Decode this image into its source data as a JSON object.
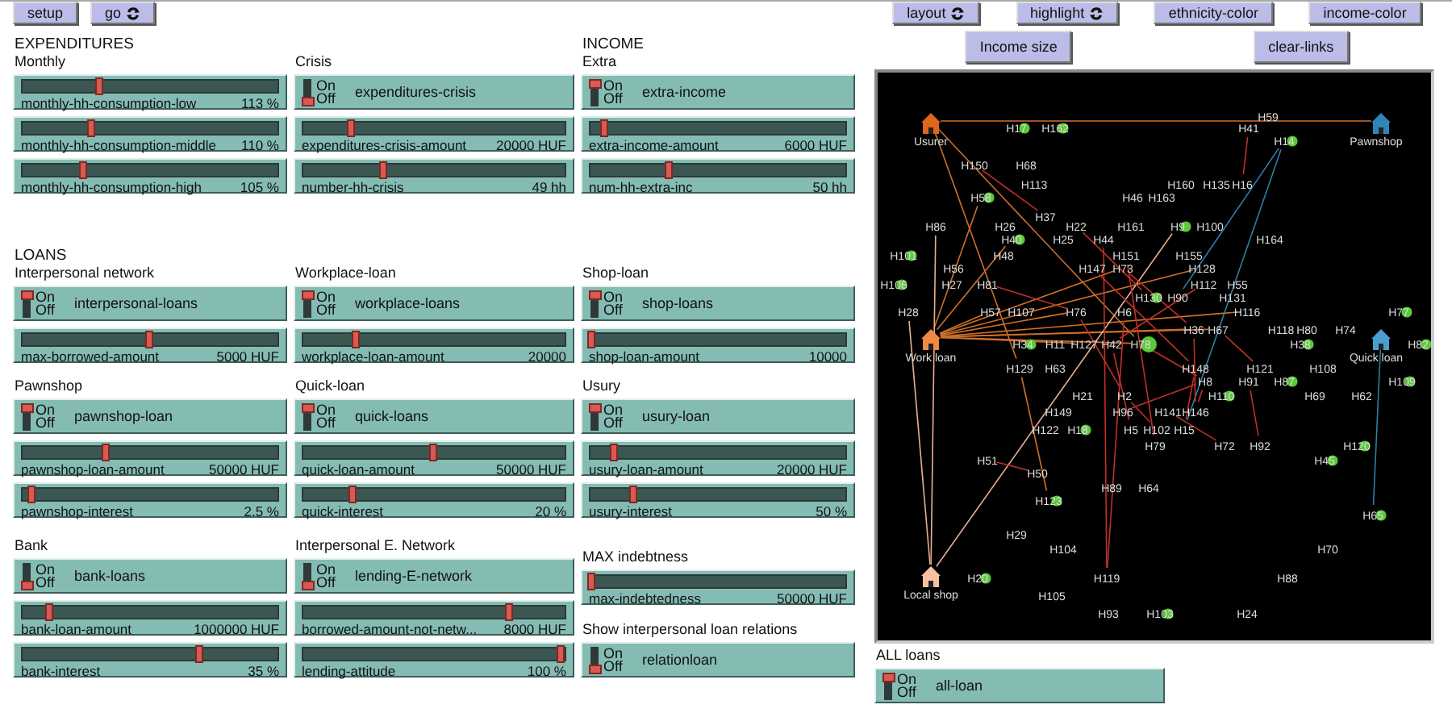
{
  "toolbar": [
    {
      "label": "setup",
      "forever": false
    },
    {
      "label": "go",
      "forever": true
    }
  ],
  "rows": [
    {
      "cells": [
        {
          "heading": "EXPENDITURES",
          "groups": [
            {
              "title": "Monthly",
              "widgets": [
                {
                  "kind": "slider",
                  "name": "monthly-hh-consumption-low",
                  "value": "113 %",
                  "level": 0.3
                },
                {
                  "kind": "slider",
                  "name": "monthly-hh-consumption-middle",
                  "value": "110 %",
                  "level": 0.27
                },
                {
                  "kind": "slider",
                  "name": "monthly-hh-consumption-high",
                  "value": "105 %",
                  "level": 0.24
                }
              ]
            }
          ]
        },
        {
          "groups": [
            {
              "title": "Crisis",
              "widgets": [
                {
                  "kind": "switch",
                  "name": "expenditures-crisis",
                  "on_label": "On",
                  "off_label": "Off",
                  "on": false
                },
                {
                  "kind": "slider",
                  "name": "expenditures-crisis-amount",
                  "value": "20000 HUF",
                  "level": 0.18
                },
                {
                  "kind": "slider",
                  "name": "number-hh-crisis",
                  "value": "49 hh",
                  "level": 0.31
                }
              ]
            }
          ]
        },
        {
          "heading": "INCOME",
          "groups": [
            {
              "title": "Extra",
              "widgets": [
                {
                  "kind": "switch",
                  "name": "extra-income",
                  "on_label": "On",
                  "off_label": "Off",
                  "on": true
                },
                {
                  "kind": "slider",
                  "name": "extra-income-amount",
                  "value": "6000 HUF",
                  "level": 0.05
                },
                {
                  "kind": "slider",
                  "name": "num-hh-extra-inc",
                  "value": "50 hh",
                  "level": 0.31
                }
              ]
            }
          ]
        }
      ]
    },
    {
      "cells": [
        {
          "heading": "LOANS",
          "groups": [
            {
              "title": "Interpersonal network",
              "widgets": [
                {
                  "kind": "switch",
                  "name": "interpersonal-loans",
                  "on_label": "On",
                  "off_label": "Off",
                  "on": true
                },
                {
                  "kind": "slider",
                  "name": "max-borrowed-amount",
                  "value": "5000 HUF",
                  "level": 0.5
                }
              ]
            }
          ]
        },
        {
          "groups": [
            {
              "title": "Workplace-loan",
              "widgets": [
                {
                  "kind": "switch",
                  "name": "workplace-loans",
                  "on_label": "On",
                  "off_label": "Off",
                  "on": true
                },
                {
                  "kind": "slider",
                  "name": "workplace-loan-amount",
                  "value": "20000",
                  "level": 0.2
                }
              ]
            }
          ]
        },
        {
          "groups": [
            {
              "title": "Shop-loan",
              "widgets": [
                {
                  "kind": "switch",
                  "name": "shop-loans",
                  "on_label": "On",
                  "off_label": "Off",
                  "on": true
                },
                {
                  "kind": "slider",
                  "name": "shop-loan-amount",
                  "value": "10000",
                  "level": 0
                }
              ]
            }
          ]
        }
      ]
    },
    {
      "cells": [
        {
          "groups": [
            {
              "title": "Pawnshop",
              "widgets": [
                {
                  "kind": "switch",
                  "name": "pawnshop-loan",
                  "on_label": "On",
                  "off_label": "Off",
                  "on": true
                },
                {
                  "kind": "slider",
                  "name": "pawnshop-loan-amount",
                  "value": "50000 HUF",
                  "level": 0.33
                },
                {
                  "kind": "slider",
                  "name": "pawnshop-interest",
                  "value": "2.5 %",
                  "level": 0.03
                }
              ]
            }
          ]
        },
        {
          "groups": [
            {
              "title": "Quick-loan",
              "widgets": [
                {
                  "kind": "switch",
                  "name": "quick-loans",
                  "on_label": "On",
                  "off_label": "Off",
                  "on": true
                },
                {
                  "kind": "slider",
                  "name": "quick-loan-amount",
                  "value": "50000 HUF",
                  "level": 0.5
                },
                {
                  "kind": "slider",
                  "name": "quick-interest",
                  "value": "20 %",
                  "level": 0.19
                }
              ]
            }
          ]
        },
        {
          "groups": [
            {
              "title": "Usury",
              "widgets": [
                {
                  "kind": "switch",
                  "name": "usury-loan",
                  "on_label": "On",
                  "off_label": "Off",
                  "on": true
                },
                {
                  "kind": "slider",
                  "name": "usury-loan-amount",
                  "value": "20000 HUF",
                  "level": 0.09
                },
                {
                  "kind": "slider",
                  "name": "usury-interest",
                  "value": "50 %",
                  "level": 0.17
                }
              ]
            }
          ]
        }
      ]
    },
    {
      "cells": [
        {
          "groups": [
            {
              "title": "Bank",
              "widgets": [
                {
                  "kind": "switch",
                  "name": "bank-loans",
                  "on_label": "On",
                  "off_label": "Off",
                  "on": false
                },
                {
                  "kind": "slider",
                  "name": "bank-loan-amount",
                  "value": "1000000 HUF",
                  "level": 0.1
                },
                {
                  "kind": "slider",
                  "name": "bank-interest",
                  "value": "35 %",
                  "level": 0.7
                }
              ]
            }
          ]
        },
        {
          "groups": [
            {
              "title": "Interpersonal E. Network",
              "widgets": [
                {
                  "kind": "switch",
                  "name": "lending-E-network",
                  "on_label": "On",
                  "off_label": "Off",
                  "on": false
                },
                {
                  "kind": "slider",
                  "name": "borrowed-amount-not-netw...",
                  "value": "8000 HUF",
                  "level": 0.8
                },
                {
                  "kind": "slider",
                  "name": "lending-attitude",
                  "value": "100 %",
                  "level": 1
                }
              ]
            }
          ]
        },
        {
          "groups": [
            {
              "title": "MAX indebtness",
              "widgets": [
                {
                  "kind": "slider",
                  "name": "max-indebtedness",
                  "value": "50000 HUF",
                  "level": 0
                }
              ]
            },
            {
              "title": "Show interpersonal loan relations",
              "widgets": [
                {
                  "kind": "switch",
                  "name": "relationloan",
                  "on_label": "On",
                  "off_label": "Off",
                  "on": false
                }
              ]
            }
          ]
        }
      ]
    }
  ],
  "view_buttons": [
    [
      {
        "label": "layout",
        "forever": true
      },
      {
        "label": "highlight",
        "forever": true
      },
      {
        "label": "ethnicity-color",
        "forever": false
      },
      {
        "label": "income-color",
        "forever": false
      }
    ],
    [
      {
        "label": "Income size",
        "forever": false
      },
      {
        "label": "clear-links",
        "forever": false
      }
    ]
  ],
  "view": {
    "nodes": [
      {
        "kind": "household",
        "label": "H59"
      },
      {
        "kind": "household",
        "label": "H17",
        "color": "#5cc83a"
      },
      {
        "kind": "household",
        "label": "H162",
        "color": "#5cc83a"
      },
      {
        "kind": "household",
        "label": "H41"
      },
      {
        "kind": "house",
        "label": "Usurer",
        "color": "#e0661c"
      },
      {
        "kind": "household",
        "label": "H14",
        "color": "#5cc83a"
      },
      {
        "kind": "house",
        "label": "Pawnshop",
        "color": "#2e86b8"
      },
      {
        "kind": "household",
        "label": "H150"
      },
      {
        "kind": "household",
        "label": "H68"
      },
      {
        "kind": "household",
        "label": "H113"
      },
      {
        "kind": "household",
        "label": "H160"
      },
      {
        "kind": "household",
        "label": "H135"
      },
      {
        "kind": "household",
        "label": "H16"
      },
      {
        "kind": "household",
        "label": "H58",
        "color": "#5cc83a"
      },
      {
        "kind": "household",
        "label": "H46"
      },
      {
        "kind": "household",
        "label": "H163"
      },
      {
        "kind": "household",
        "label": "H37"
      },
      {
        "kind": "household",
        "label": "H86"
      },
      {
        "kind": "household",
        "label": "H26"
      },
      {
        "kind": "household",
        "label": "H22"
      },
      {
        "kind": "household",
        "label": "H161"
      },
      {
        "kind": "household",
        "label": "H9",
        "color": "#5cc83a"
      },
      {
        "kind": "household",
        "label": "H100"
      },
      {
        "kind": "household",
        "label": "H40",
        "color": "#5cc83a"
      },
      {
        "kind": "household",
        "label": "H25"
      },
      {
        "kind": "household",
        "label": "H44"
      },
      {
        "kind": "household",
        "label": "H164"
      },
      {
        "kind": "household",
        "label": "H101",
        "color": "#5cc83a"
      },
      {
        "kind": "household",
        "label": "H48"
      },
      {
        "kind": "household",
        "label": "H151"
      },
      {
        "kind": "household",
        "label": "H155"
      },
      {
        "kind": "household",
        "label": "H56"
      },
      {
        "kind": "household",
        "label": "H147"
      },
      {
        "kind": "household",
        "label": "H73"
      },
      {
        "kind": "household",
        "label": "H128"
      },
      {
        "kind": "household",
        "label": "H106",
        "color": "#5cc83a"
      },
      {
        "kind": "household",
        "label": "H27"
      },
      {
        "kind": "household",
        "label": "H81"
      },
      {
        "kind": "household",
        "label": "H112"
      },
      {
        "kind": "household",
        "label": "H55"
      },
      {
        "kind": "household",
        "label": "H130",
        "color": "#5cc83a"
      },
      {
        "kind": "household",
        "label": "H90"
      },
      {
        "kind": "household",
        "label": "H131"
      },
      {
        "kind": "household",
        "label": "H28"
      },
      {
        "kind": "household",
        "label": "H57"
      },
      {
        "kind": "household",
        "label": "H107"
      },
      {
        "kind": "household",
        "label": "H76"
      },
      {
        "kind": "household",
        "label": "H6"
      },
      {
        "kind": "household",
        "label": "H116"
      },
      {
        "kind": "household",
        "label": "H77",
        "color": "#5cc83a"
      },
      {
        "kind": "household",
        "label": "H36"
      },
      {
        "kind": "household",
        "label": "H67"
      },
      {
        "kind": "household",
        "label": "H118"
      },
      {
        "kind": "household",
        "label": "H80"
      },
      {
        "kind": "household",
        "label": "H74"
      },
      {
        "kind": "household",
        "label": "H34",
        "color": "#5cc83a"
      },
      {
        "kind": "household",
        "label": "H11"
      },
      {
        "kind": "household",
        "label": "H127"
      },
      {
        "kind": "household",
        "label": "H42"
      },
      {
        "kind": "household",
        "label": "H78",
        "color": "#5cc83a"
      },
      {
        "kind": "household",
        "label": "H38",
        "color": "#5cc83a"
      },
      {
        "kind": "household",
        "label": "H82",
        "color": "#5cc83a"
      },
      {
        "kind": "house",
        "label": "Work loan",
        "color": "#f08a40"
      },
      {
        "kind": "house",
        "label": "Quick loan",
        "color": "#4a9ed0"
      },
      {
        "kind": "household",
        "label": "H129"
      },
      {
        "kind": "household",
        "label": "H63"
      },
      {
        "kind": "household",
        "label": "H148"
      },
      {
        "kind": "household",
        "label": "H121"
      },
      {
        "kind": "household",
        "label": "H108"
      },
      {
        "kind": "household",
        "label": "H8"
      },
      {
        "kind": "household",
        "label": "H91"
      },
      {
        "kind": "household",
        "label": "H87",
        "color": "#5cc83a"
      },
      {
        "kind": "household",
        "label": "H109",
        "color": "#5cc83a"
      },
      {
        "kind": "household",
        "label": "H21"
      },
      {
        "kind": "household",
        "label": "H2"
      },
      {
        "kind": "household",
        "label": "H110",
        "color": "#5cc83a"
      },
      {
        "kind": "household",
        "label": "H69"
      },
      {
        "kind": "household",
        "label": "H62"
      },
      {
        "kind": "household",
        "label": "H149"
      },
      {
        "kind": "household",
        "label": "H96"
      },
      {
        "kind": "household",
        "label": "H141"
      },
      {
        "kind": "household",
        "label": "H146"
      },
      {
        "kind": "household",
        "label": "H122"
      },
      {
        "kind": "household",
        "label": "H18",
        "color": "#5cc83a"
      },
      {
        "kind": "household",
        "label": "H5"
      },
      {
        "kind": "household",
        "label": "H102"
      },
      {
        "kind": "household",
        "label": "H15"
      },
      {
        "kind": "household",
        "label": "H79"
      },
      {
        "kind": "household",
        "label": "H72"
      },
      {
        "kind": "household",
        "label": "H92"
      },
      {
        "kind": "household",
        "label": "H120",
        "color": "#5cc83a"
      },
      {
        "kind": "household",
        "label": "H51"
      },
      {
        "kind": "household",
        "label": "H45",
        "color": "#5cc83a"
      },
      {
        "kind": "household",
        "label": "H50"
      },
      {
        "kind": "household",
        "label": "H89"
      },
      {
        "kind": "household",
        "label": "H64"
      },
      {
        "kind": "household",
        "label": "H123",
        "color": "#5cc83a"
      },
      {
        "kind": "household",
        "label": "H65",
        "color": "#5cc83a"
      },
      {
        "kind": "household",
        "label": "H29"
      },
      {
        "kind": "household",
        "label": "H104"
      },
      {
        "kind": "household",
        "label": "H70"
      },
      {
        "kind": "household",
        "label": "H20",
        "color": "#5cc83a"
      },
      {
        "kind": "household",
        "label": "H119"
      },
      {
        "kind": "household",
        "label": "H88"
      },
      {
        "kind": "house",
        "label": "Local shop",
        "color": "#f8c0a0"
      },
      {
        "kind": "household",
        "label": "H105"
      },
      {
        "kind": "household",
        "label": "H93"
      },
      {
        "kind": "household",
        "label": "H103",
        "color": "#5cc83a"
      },
      {
        "kind": "household",
        "label": "H24"
      }
    ]
  },
  "bottom_group": {
    "title": "ALL loans",
    "widgets": [
      {
        "kind": "switch",
        "name": "all-loan",
        "on_label": "On",
        "off_label": "Off",
        "on": true
      }
    ]
  }
}
